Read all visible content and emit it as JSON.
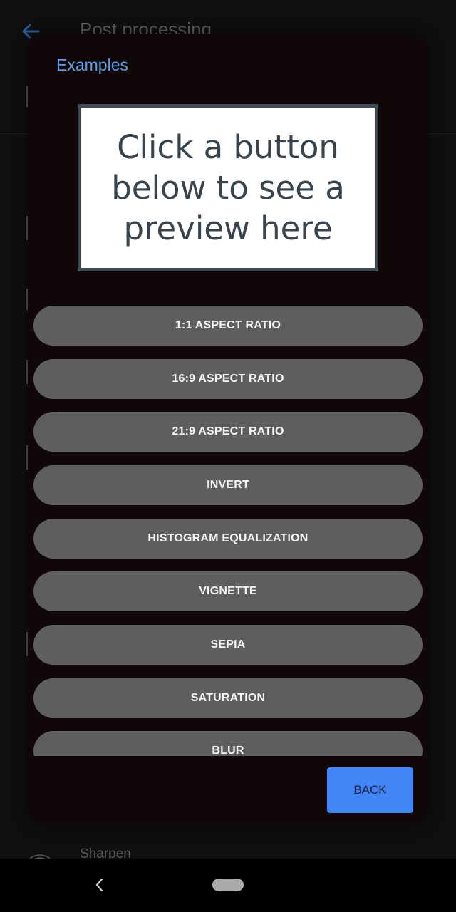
{
  "background": {
    "header_title": "Post processing",
    "sharpen_label": "Sharpen"
  },
  "dialog": {
    "title": "Examples",
    "preview_placeholder": "Click a button below to see a preview here",
    "buttons": [
      {
        "label": "1:1 ASPECT RATIO"
      },
      {
        "label": "16:9 ASPECT RATIO"
      },
      {
        "label": "21:9 ASPECT RATIO"
      },
      {
        "label": "INVERT"
      },
      {
        "label": "HISTOGRAM EQUALIZATION"
      },
      {
        "label": "VIGNETTE"
      },
      {
        "label": "SEPIA"
      },
      {
        "label": "SATURATION"
      },
      {
        "label": "BLUR"
      }
    ],
    "back_label": "BACK"
  },
  "colors": {
    "accent": "#4285f4",
    "title_blue": "#5f9fe8",
    "button_gray": "#5e5e5f"
  }
}
